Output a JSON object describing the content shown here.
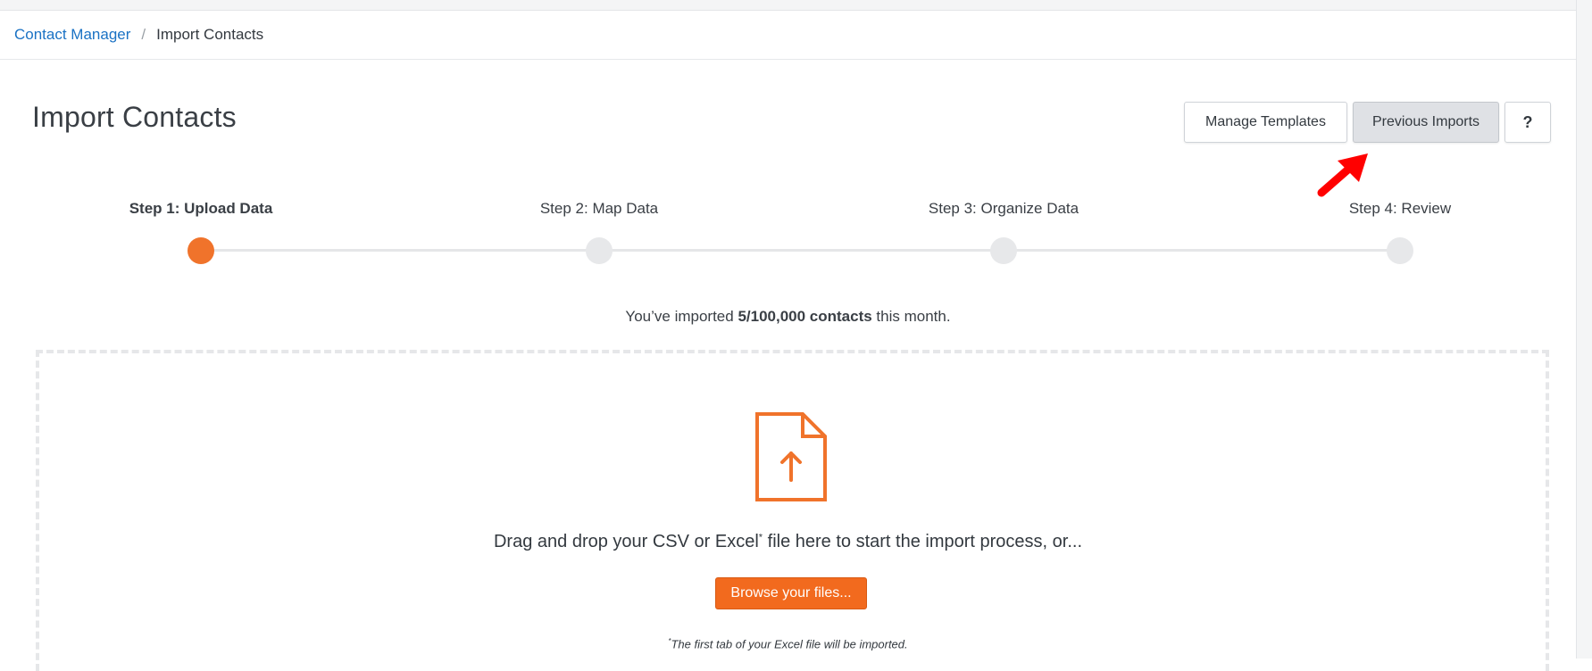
{
  "breadcrumb": {
    "parent": "Contact Manager",
    "separator": "/",
    "current": "Import Contacts"
  },
  "header": {
    "title": "Import Contacts",
    "buttons": {
      "manage_templates": "Manage Templates",
      "previous_imports": "Previous Imports",
      "help": "?"
    }
  },
  "steps": [
    {
      "label": "Step 1: Upload Data",
      "active": true
    },
    {
      "label": "Step 2: Map Data",
      "active": false
    },
    {
      "label": "Step 3: Organize Data",
      "active": false
    },
    {
      "label": "Step 4: Review",
      "active": false
    }
  ],
  "quota": {
    "prefix": "You’ve imported ",
    "count": "5/100,000 contacts",
    "suffix": " this month."
  },
  "dropzone": {
    "icon": "file-upload-icon",
    "text_before": "Drag and drop your CSV or Excel",
    "asterisk": "*",
    "text_after": " file here to start the import process, or...",
    "browse_label": "Browse your files...",
    "footnote_mark": "*",
    "footnote": "The first tab of your Excel file will be imported."
  },
  "annotation": {
    "icon": "red-pointer-arrow-icon"
  },
  "colors": {
    "accent": "#f26a1e",
    "link": "#1a72c4",
    "step_inactive": "#e7e8ea",
    "annotation_arrow": "#ff0000"
  }
}
